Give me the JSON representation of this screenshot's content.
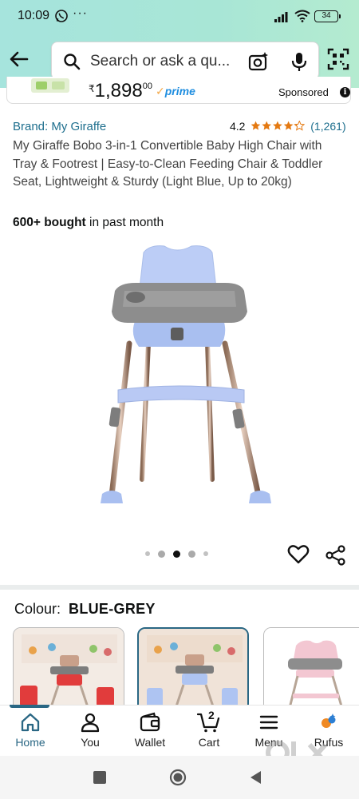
{
  "status_bar": {
    "time": "10:09",
    "more": "···",
    "battery": "34"
  },
  "search": {
    "placeholder": "Search or ask a qu..."
  },
  "sponsored": {
    "currency": "₹",
    "price_whole": "1,898",
    "price_fraction": "00",
    "prime": "prime",
    "label": "Sponsored"
  },
  "product": {
    "brand": "Brand: My Giraffe",
    "rating": "4.2",
    "rating_value": 4.2,
    "rating_count": "(1,261)",
    "title": "My Giraffe Bobo 3-in-1 Convertible Baby High Chair with Tray & Footrest | Easy-to-Clean Feeding Chair & Toddler Seat, Lightweight & Sturdy (Light Blue, Up to 20kg)",
    "bought_bold": "600+ bought",
    "bought_rest": "in past month"
  },
  "carousel": {
    "total": 5,
    "active_index": 2
  },
  "colour": {
    "label": "Colour:",
    "value": "BLUE-GREY"
  },
  "bottom_nav": {
    "items": [
      {
        "label": "Home",
        "icon": "home-icon",
        "active": true
      },
      {
        "label": "You",
        "icon": "user-icon",
        "active": false
      },
      {
        "label": "Wallet",
        "icon": "wallet-icon",
        "active": false
      },
      {
        "label": "Cart",
        "icon": "cart-icon",
        "badge": "2",
        "active": false
      },
      {
        "label": "Menu",
        "icon": "menu-icon",
        "active": false
      },
      {
        "label": "Rufus",
        "icon": "rufus-icon",
        "active": false
      }
    ]
  },
  "colors": {
    "accent": "#2a6784",
    "link": "#1d6e8d",
    "star": "#e47911",
    "header_bg": "#a8e6d6"
  }
}
